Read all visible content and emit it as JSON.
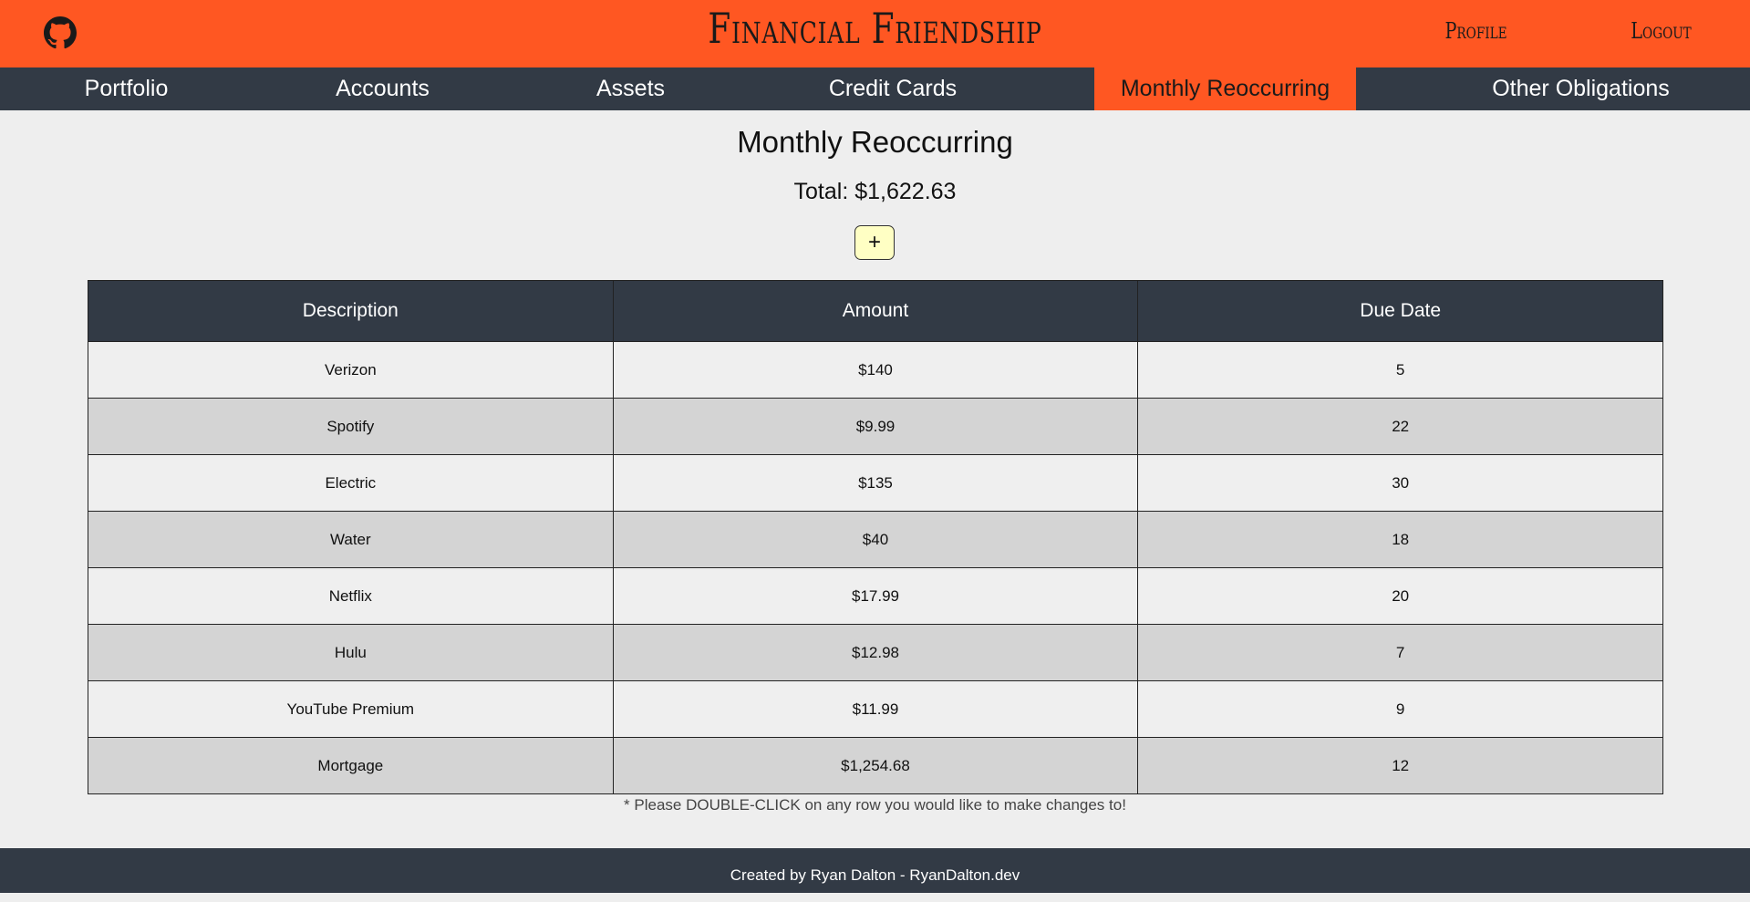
{
  "header": {
    "brand": "Financial Friendship",
    "profile_label": "Profile",
    "logout_label": "Logout",
    "github_icon": "github-icon",
    "bg_color": "#ff5722"
  },
  "nav": {
    "tabs": [
      {
        "label": "Portfolio"
      },
      {
        "label": "Accounts"
      },
      {
        "label": "Assets"
      },
      {
        "label": "Credit Cards"
      },
      {
        "label": "Monthly Reoccurring"
      },
      {
        "label": "Other Obligations"
      }
    ],
    "active": "Monthly Reoccurring",
    "bg_color": "#323a45"
  },
  "main": {
    "title": "Monthly Reoccurring",
    "total": "Total: $1,622.63",
    "add_label": "+",
    "table": {
      "headers": [
        "Description",
        "Amount",
        "Due Date"
      ],
      "rows": [
        [
          "Verizon",
          "$140",
          "5"
        ],
        [
          "Spotify",
          "$9.99",
          "22"
        ],
        [
          "Electric",
          "$135",
          "30"
        ],
        [
          "Water",
          "$40",
          "18"
        ],
        [
          "Netflix",
          "$17.99",
          "20"
        ],
        [
          "Hulu",
          "$12.98",
          "7"
        ],
        [
          "YouTube Premium",
          "$11.99",
          "9"
        ],
        [
          "Mortgage",
          "$1,254.68",
          "12"
        ]
      ]
    },
    "note": "* Please DOUBLE-CLICK on any row you would like to make changes to!"
  },
  "footer": {
    "text": "Created by Ryan Dalton - RyanDalton.dev"
  }
}
